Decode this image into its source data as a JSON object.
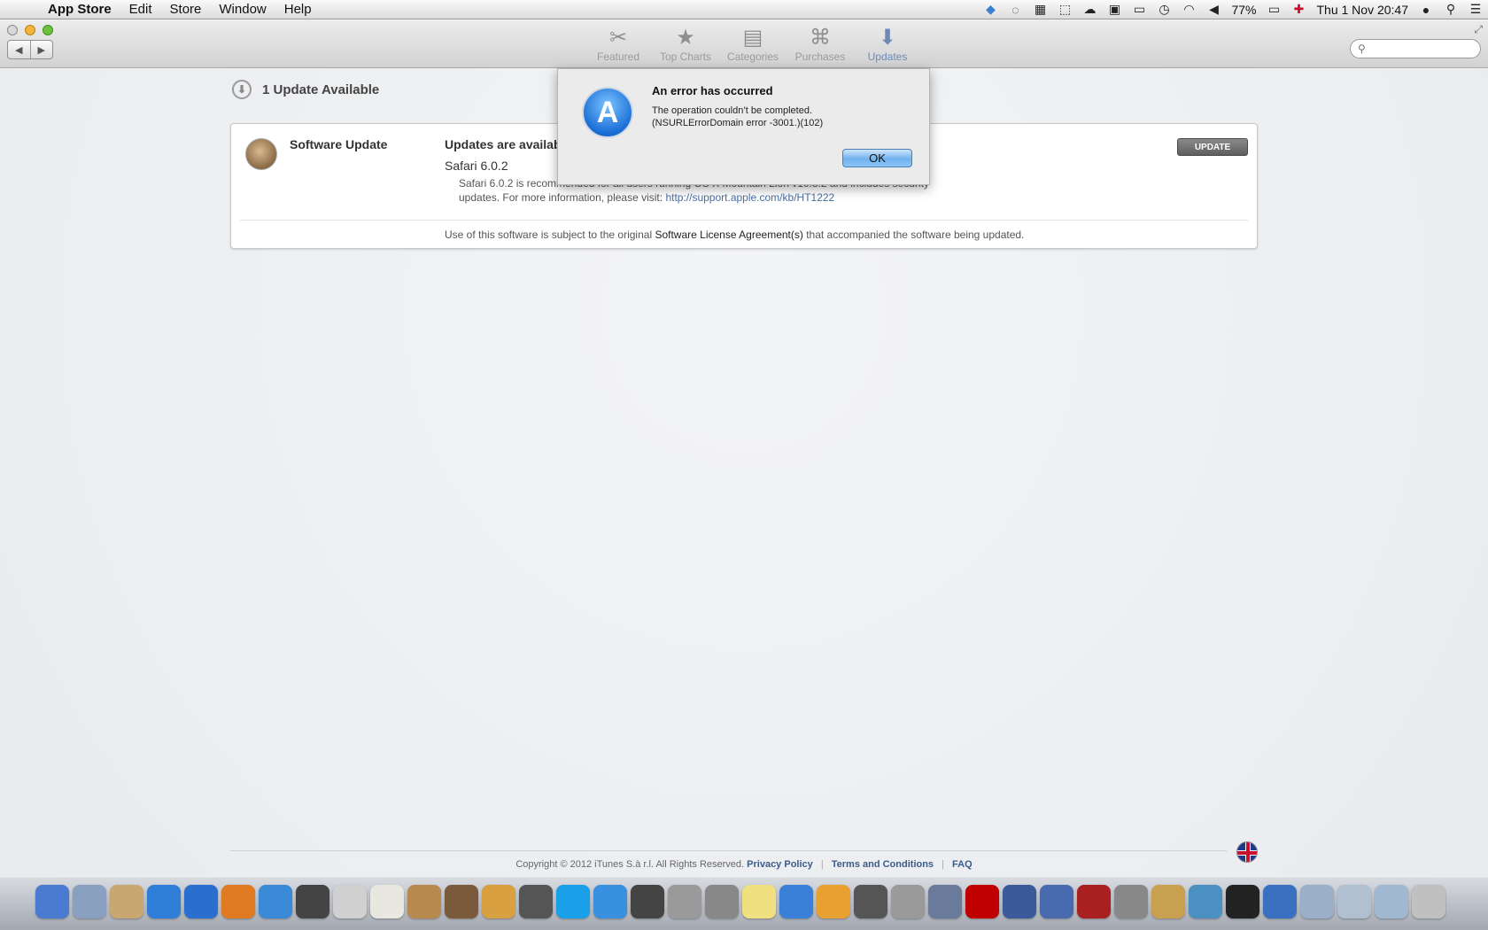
{
  "menubar": {
    "app_name": "App Store",
    "menus": [
      "Edit",
      "Store",
      "Window",
      "Help"
    ],
    "battery": "77%",
    "datetime": "Thu 1 Nov  20:47"
  },
  "toolbar": {
    "tabs": [
      {
        "label": "Featured",
        "icon": "featured-icon"
      },
      {
        "label": "Top Charts",
        "icon": "star-icon"
      },
      {
        "label": "Categories",
        "icon": "categories-icon"
      },
      {
        "label": "Purchases",
        "icon": "tag-icon"
      },
      {
        "label": "Updates",
        "icon": "download-icon"
      }
    ],
    "active_tab": "Updates"
  },
  "main": {
    "header": "1 Update Available",
    "update": {
      "app_name": "Software Update",
      "headline": "Updates are available for your computer",
      "version": "Safari 6.0.2",
      "description": "Safari 6.0.2 is recommended for all users running OS X Mountain Lion v10.8.2 and includes security updates. For more information, please visit: ",
      "link": "http://support.apple.com/kb/HT1222",
      "license_prefix": "Use of this software is subject to the original ",
      "license_link": "Software License Agreement(s)",
      "license_suffix": " that accompanied the software being updated.",
      "button": "UPDATE"
    }
  },
  "dialog": {
    "title": "An error has occurred",
    "line1": "The operation couldn’t be completed.",
    "line2": "(NSURLErrorDomain error -3001.)(102)",
    "ok": "OK"
  },
  "footer": {
    "copyright": "Copyright © 2012 iTunes S.à r.l. All Rights Reserved.",
    "privacy": "Privacy Policy",
    "terms": "Terms and Conditions",
    "faq": "FAQ",
    "separator": "|"
  },
  "dock": {
    "colors": [
      "#4a7bd0",
      "#8aa0c0",
      "#c8a870",
      "#2f7fd8",
      "#2a6fd0",
      "#e07a20",
      "#3a8ad8",
      "#444444",
      "#d0d0d0",
      "#e8e8e0",
      "#b88a50",
      "#7a5a3a",
      "#d8a040",
      "#555555",
      "#1aa0e8",
      "#3a90e0",
      "#444444",
      "#9a9a9a",
      "#888888",
      "#f0e080",
      "#3a80d8",
      "#e8a030",
      "#555555",
      "#9a9a9a",
      "#6a7a9a",
      "#c00000",
      "#3a5a9a",
      "#4a6ab0",
      "#aa2020",
      "#888888",
      "#c8a050",
      "#4a90c0",
      "#222222",
      "#3a70c0",
      "#9ab0c8",
      "#b0c0d0",
      "#a0b8d0",
      "#c0c0c0"
    ]
  }
}
